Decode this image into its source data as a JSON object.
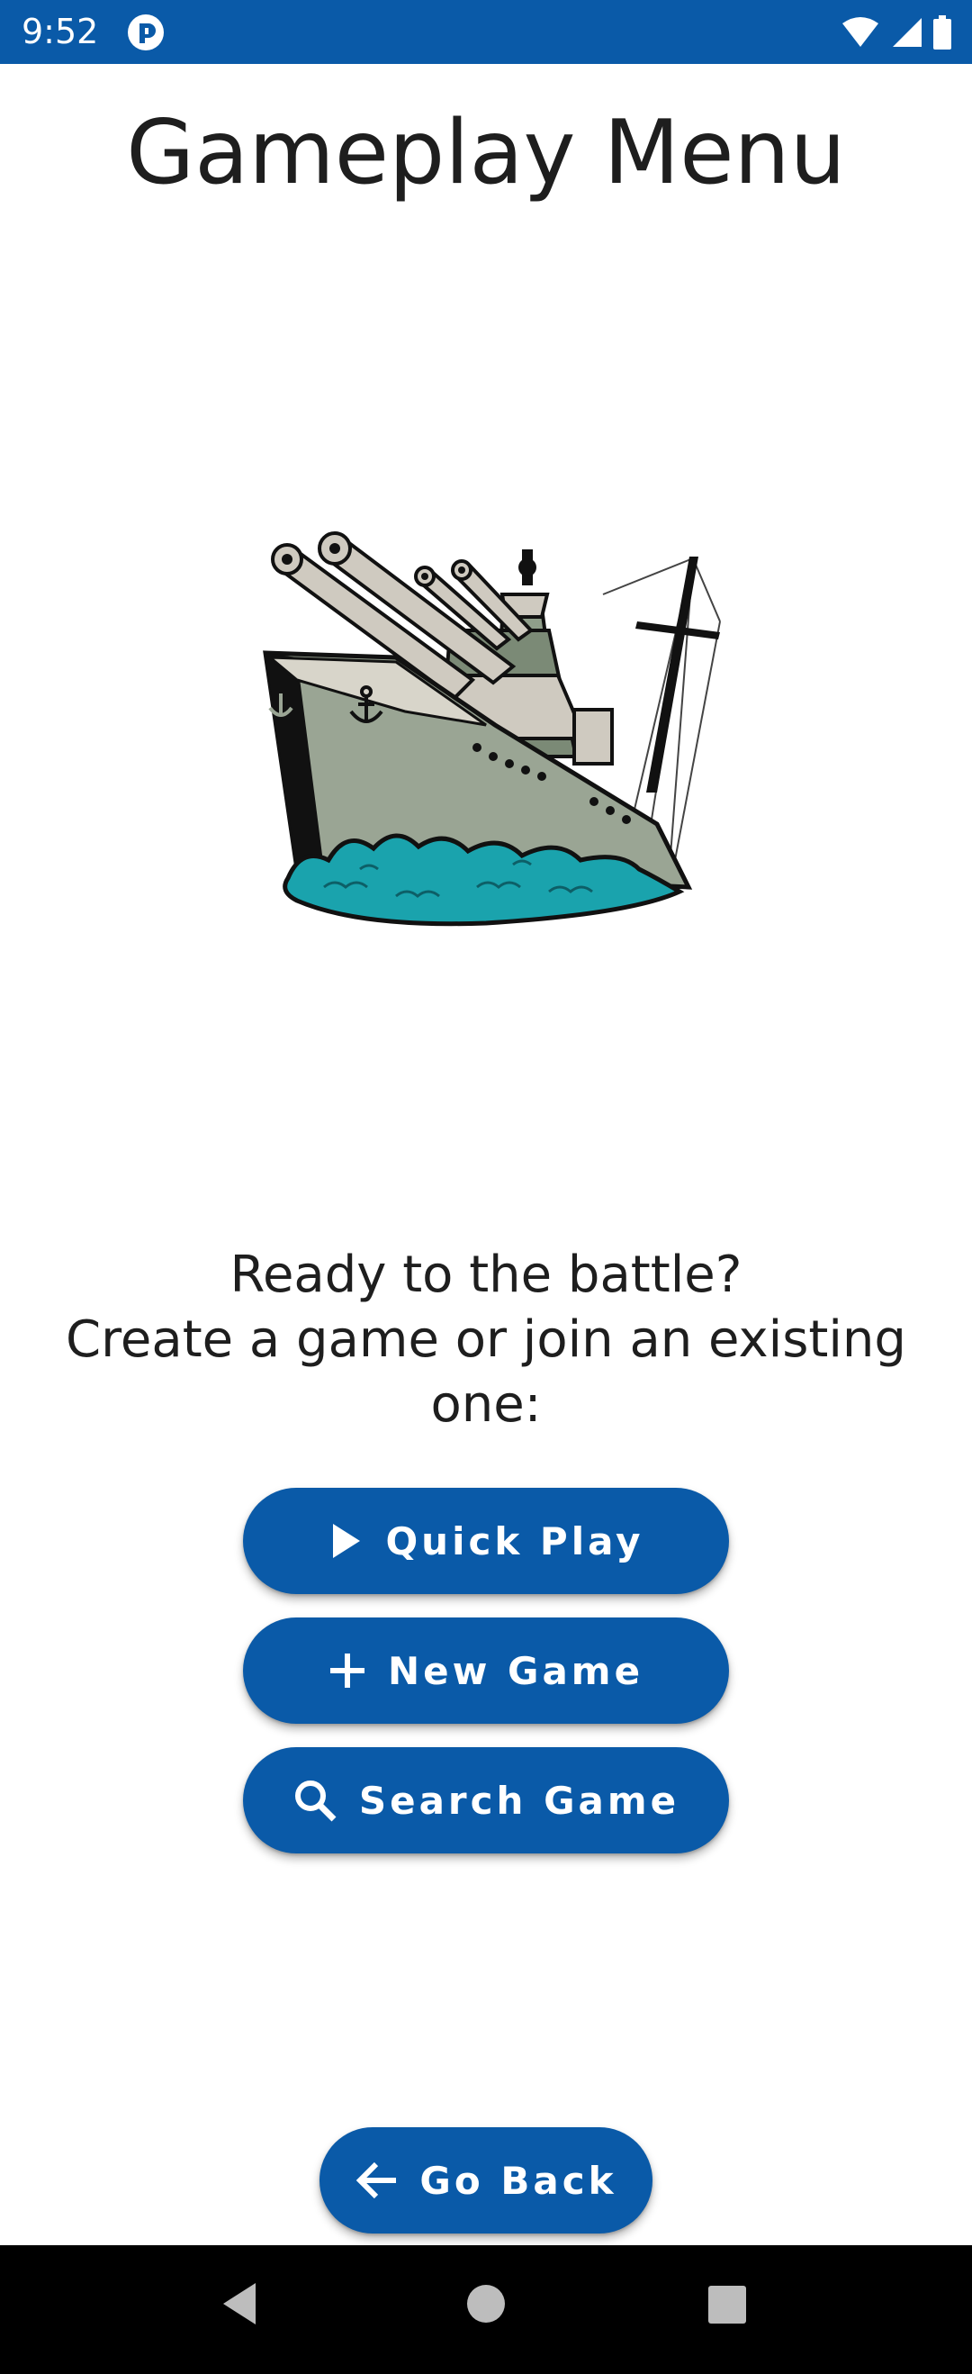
{
  "status_bar": {
    "time": "9:52",
    "icons": [
      "app-notification-icon",
      "wifi-icon",
      "signal-icon",
      "battery-icon"
    ]
  },
  "page": {
    "title": "Gameplay Menu",
    "image": "battleship-illustration",
    "prompt_lines": [
      "Ready to the battle?",
      "Create a game or join an existing",
      "one:"
    ]
  },
  "buttons": {
    "quick_play": {
      "label": "Quick Play",
      "icon": "play-icon"
    },
    "new_game": {
      "label": "New Game",
      "icon": "plus-icon"
    },
    "search_game": {
      "label": "Search Game",
      "icon": "search-icon"
    },
    "go_back": {
      "label": "Go Back",
      "icon": "arrow-left-icon"
    }
  },
  "colors": {
    "accent": "#0a5aa8",
    "text": "#1e1e1e",
    "nav_bar": "#000000"
  },
  "nav_bar": {
    "icons": [
      "back-triangle-icon",
      "home-circle-icon",
      "recents-square-icon"
    ]
  }
}
